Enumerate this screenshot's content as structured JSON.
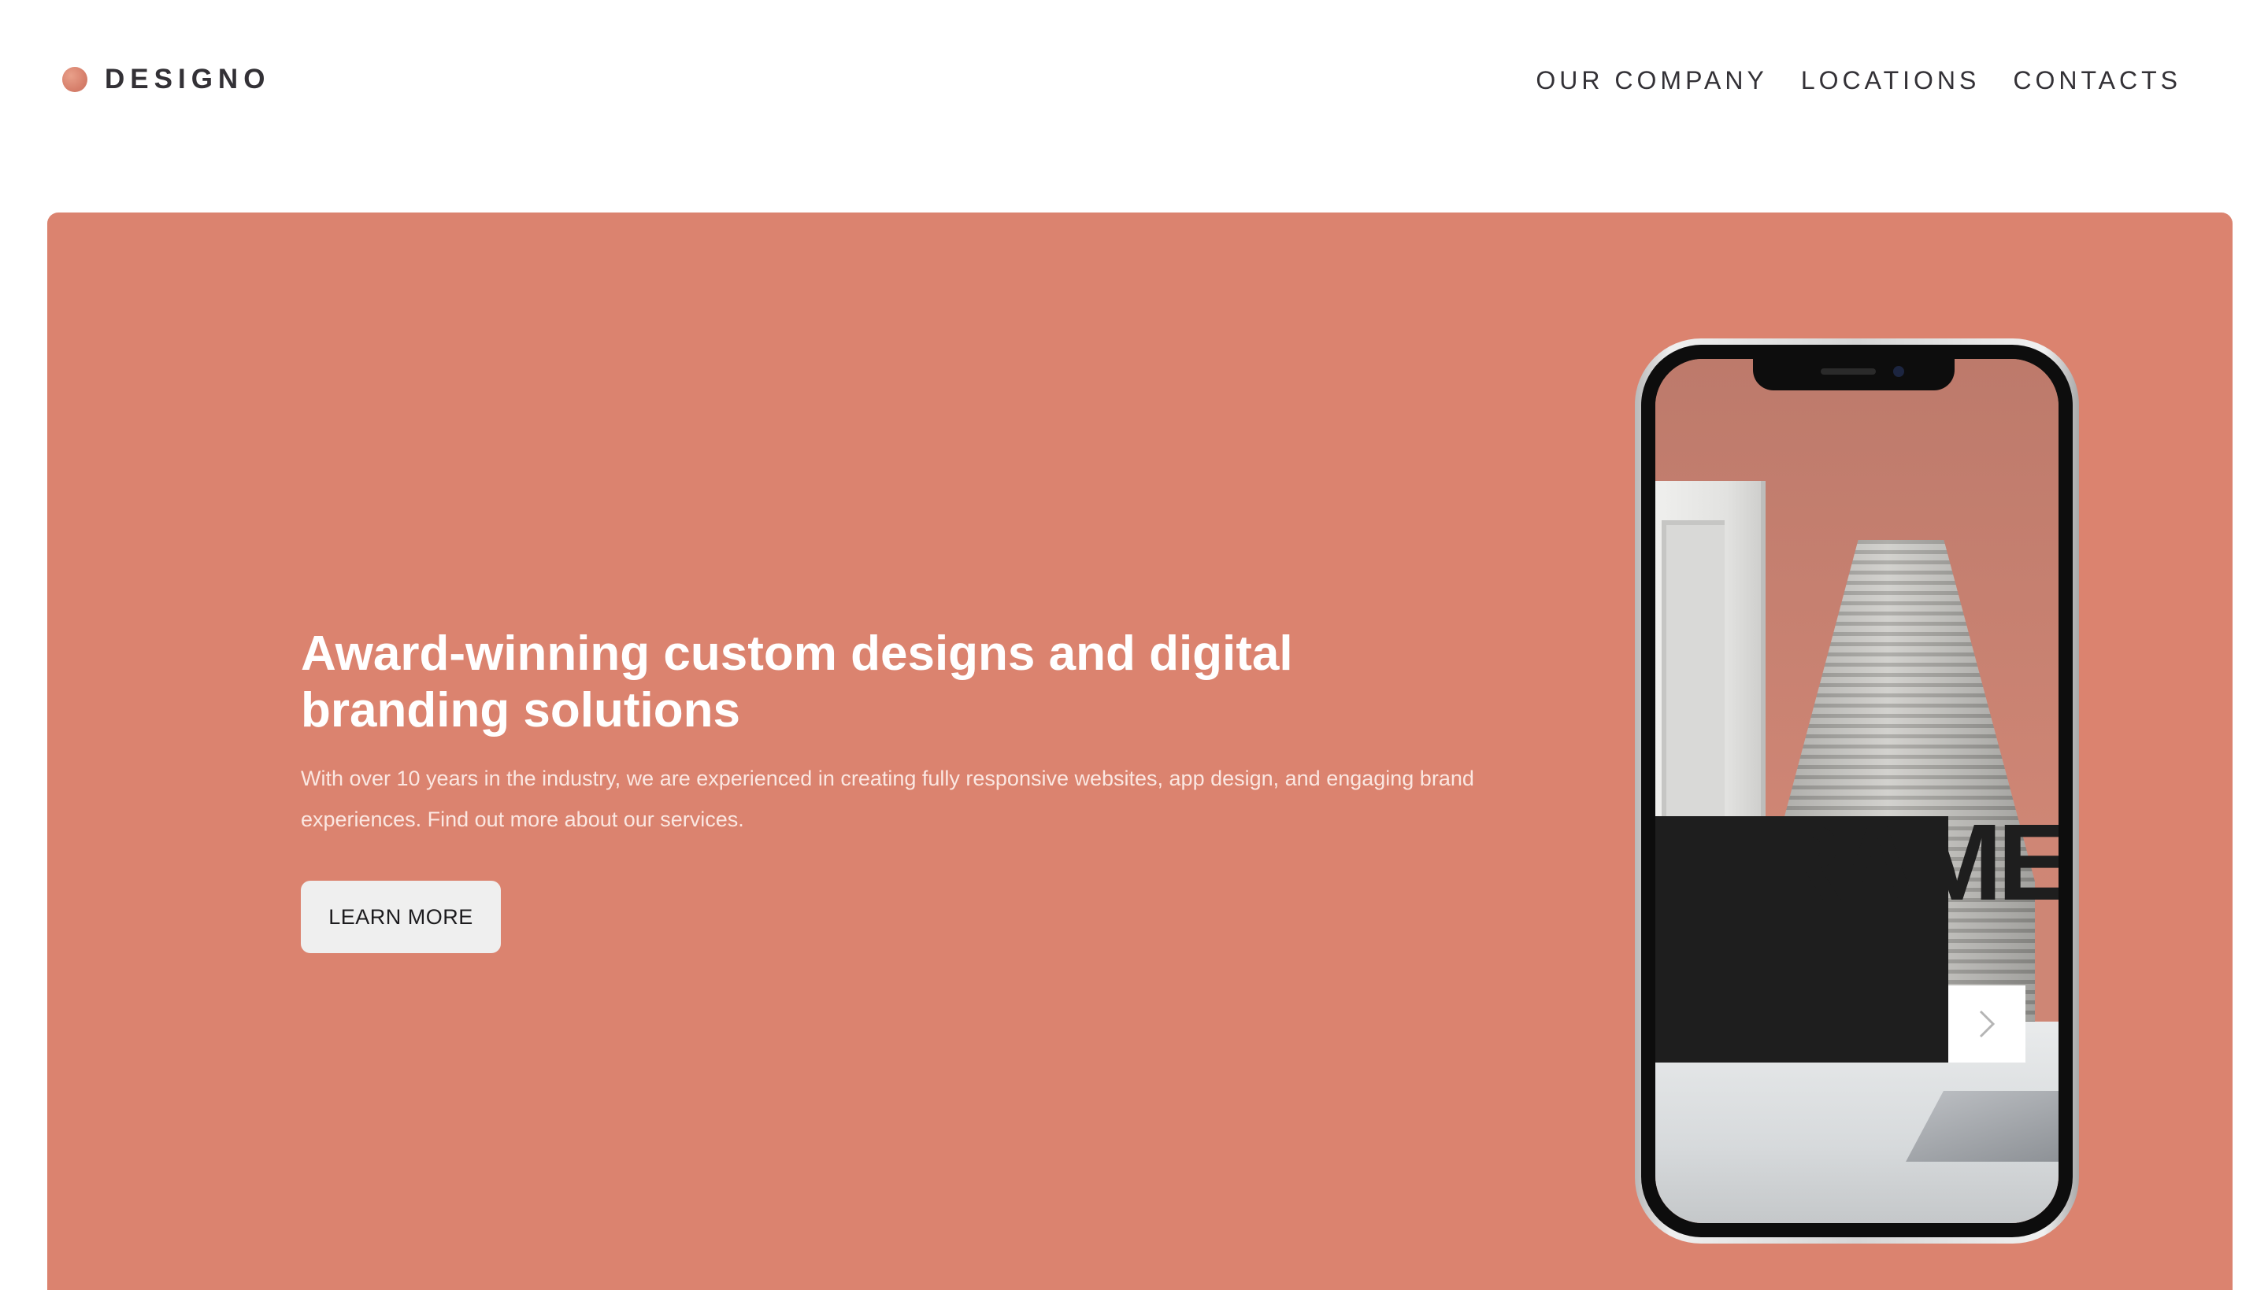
{
  "brand": {
    "name": "DESIGNO",
    "accent": "#db836f"
  },
  "nav": {
    "items": [
      "OUR COMPANY",
      "LOCATIONS",
      "CONTACTS"
    ]
  },
  "hero": {
    "title": "Award-winning custom designs and digital branding solutions",
    "text": "With over 10 years in the industry, we are experienced in creating fully responsive websites, app design, and engaging brand experiences. Find out more about our services.",
    "cta": "LEARN MORE"
  },
  "phone": {
    "screen_word": "FRAME",
    "next_icon": "chevron-right-icon"
  }
}
